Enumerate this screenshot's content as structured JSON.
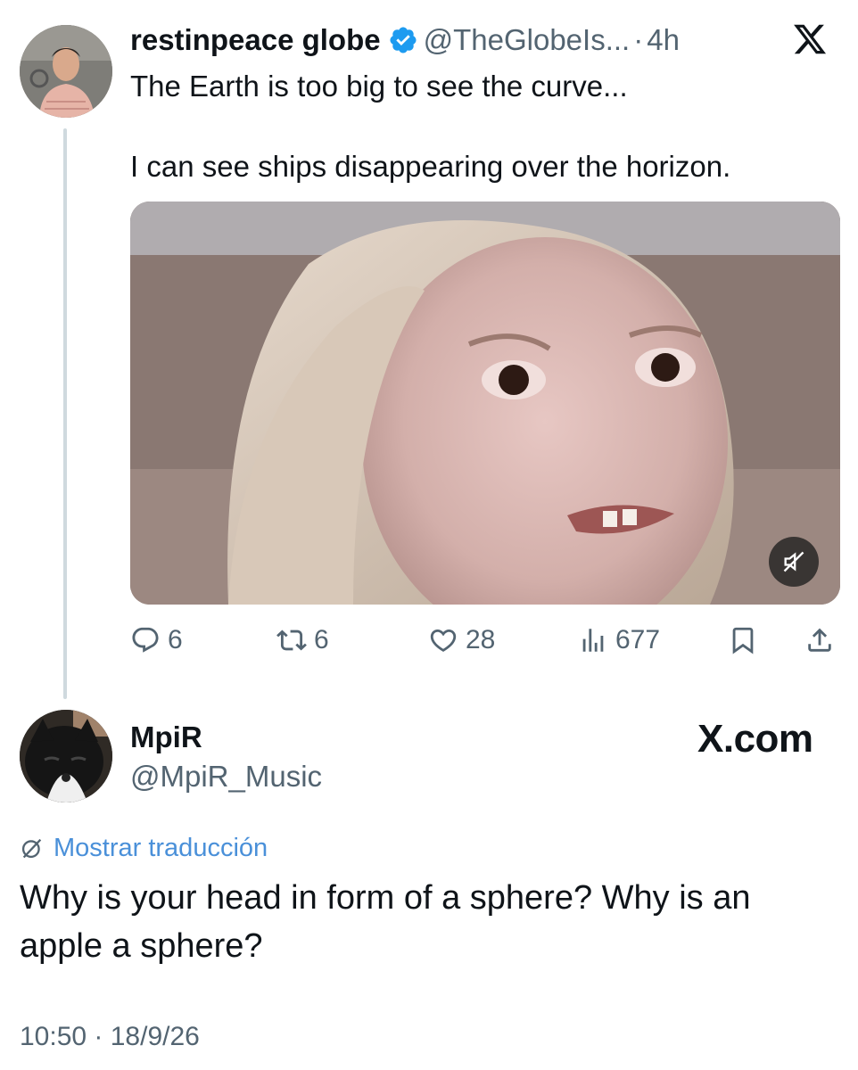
{
  "tweet": {
    "display_name": "restinpeace globe",
    "handle": "@TheGlobeIs...",
    "separator": "·",
    "time": "4h",
    "text_line_1": "The Earth is too big to see the curve...",
    "text_line_2": "I can see ships disappearing over the horizon.",
    "actions": {
      "replies": "6",
      "reposts": "6",
      "likes": "28",
      "views": "677"
    }
  },
  "reply": {
    "display_name": "MpiR",
    "handle": "@MpiR_Music",
    "watermark": "X.com",
    "translate_label": "Mostrar traducción",
    "text": "Why is your head in form of a sphere? Why is an apple a sphere?",
    "timestamp": "10:50 · 18/9/26"
  },
  "colors": {
    "text_primary": "#0f1419",
    "text_secondary": "#536471",
    "verified_blue": "#1d9bf0",
    "translate_blue": "#4a90d9",
    "thread_line": "#cfd9de"
  },
  "icons": {
    "verified": "verified-badge-icon",
    "x_logo": "x-logo-icon",
    "reply": "reply-icon",
    "repost": "repost-icon",
    "like": "heart-icon",
    "views": "views-icon",
    "bookmark": "bookmark-icon",
    "share": "share-icon",
    "mute": "mute-icon",
    "translate": "translate-icon"
  }
}
